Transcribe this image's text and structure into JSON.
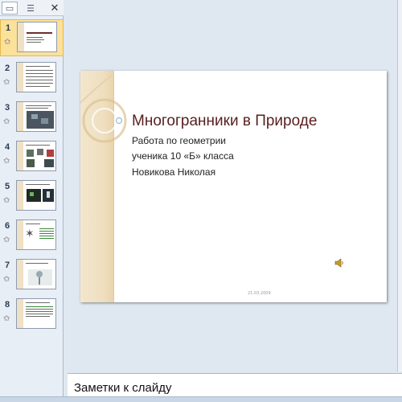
{
  "left_panel": {
    "tabs": {
      "slides_icon": "slides-tab-icon",
      "outline_icon": "outline-tab-icon",
      "close_glyph": "✕"
    },
    "thumbnails": [
      {
        "number": "1",
        "active": true
      },
      {
        "number": "2"
      },
      {
        "number": "3"
      },
      {
        "number": "4"
      },
      {
        "number": "5"
      },
      {
        "number": "6"
      },
      {
        "number": "7"
      },
      {
        "number": "8"
      }
    ],
    "animation_icon": "star-icon"
  },
  "slide": {
    "title": "Многогранники в Природе",
    "subtitle_lines": [
      "Работа по геометрии",
      "ученика 10 «Б» класса",
      "Новикова Николая"
    ],
    "date": "21.03.2009",
    "sound_icon": "speaker-icon"
  },
  "notes": {
    "placeholder": "Заметки к слайду"
  },
  "colors": {
    "accent_title": "#5a2020",
    "active_thumb": "#fbe19a",
    "band": "#efdfc0"
  }
}
